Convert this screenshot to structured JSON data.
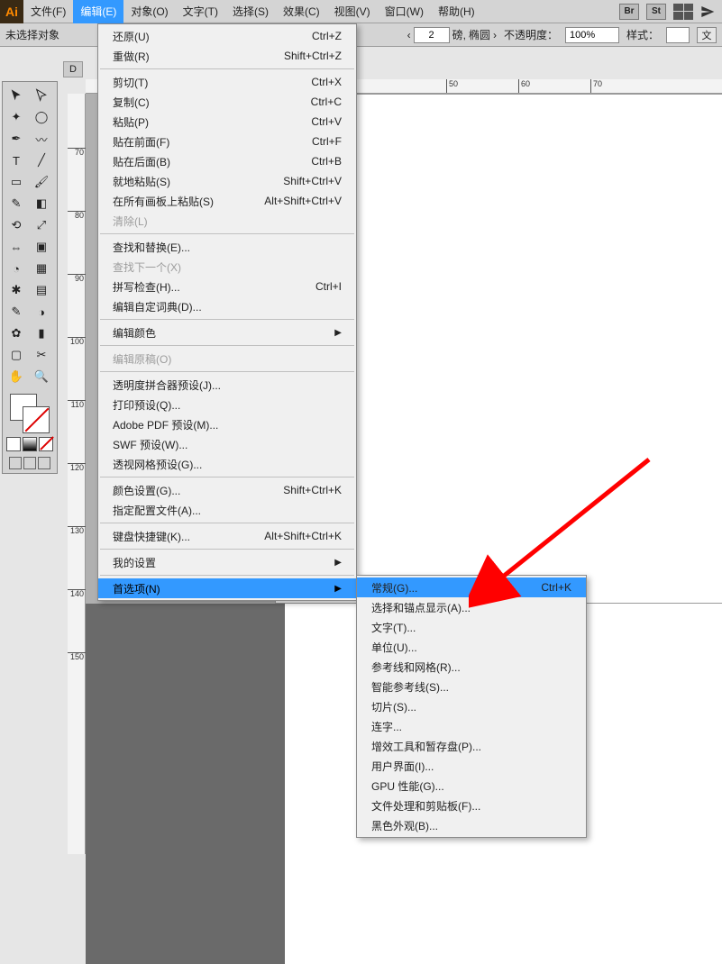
{
  "logo_text": "Ai",
  "menu": {
    "file": "文件(F)",
    "edit": "编辑(E)",
    "object": "对象(O)",
    "type": "文字(T)",
    "select": "选择(S)",
    "effect": "效果(C)",
    "view": "视图(V)",
    "window": "窗口(W)",
    "help": "帮助(H)"
  },
  "right_buttons": {
    "br": "Br",
    "st": "St"
  },
  "options": {
    "no_selection": "未选择对象",
    "stroke_val": "2",
    "stroke_unit": "磅,",
    "stroke_style": "椭圆",
    "opacity_label": "不透明度：",
    "opacity_val": "100%",
    "style_label": "样式：",
    "doc_btn": "文"
  },
  "tab": {
    "label": "D"
  },
  "h_ticks": [
    "50",
    "60",
    "70"
  ],
  "v_ticks": [
    "70",
    "80",
    "90",
    "100",
    "110",
    "120",
    "130",
    "140",
    "150"
  ],
  "dropdown": [
    {
      "label": "还原(U)",
      "short": "Ctrl+Z"
    },
    {
      "label": "重做(R)",
      "short": "Shift+Ctrl+Z"
    },
    {
      "sep": true
    },
    {
      "label": "剪切(T)",
      "short": "Ctrl+X"
    },
    {
      "label": "复制(C)",
      "short": "Ctrl+C"
    },
    {
      "label": "粘贴(P)",
      "short": "Ctrl+V"
    },
    {
      "label": "贴在前面(F)",
      "short": "Ctrl+F"
    },
    {
      "label": "贴在后面(B)",
      "short": "Ctrl+B"
    },
    {
      "label": "就地粘贴(S)",
      "short": "Shift+Ctrl+V"
    },
    {
      "label": "在所有画板上粘贴(S)",
      "short": "Alt+Shift+Ctrl+V"
    },
    {
      "label": "清除(L)",
      "disabled": true
    },
    {
      "sep": true
    },
    {
      "label": "查找和替换(E)..."
    },
    {
      "label": "查找下一个(X)",
      "disabled": true
    },
    {
      "label": "拼写检查(H)...",
      "short": "Ctrl+I"
    },
    {
      "label": "编辑自定词典(D)..."
    },
    {
      "sep": true
    },
    {
      "label": "编辑颜色",
      "arrow": true
    },
    {
      "sep": true
    },
    {
      "label": "编辑原稿(O)",
      "disabled": true
    },
    {
      "sep": true
    },
    {
      "label": "透明度拼合器预设(J)..."
    },
    {
      "label": "打印预设(Q)..."
    },
    {
      "label": "Adobe PDF 预设(M)..."
    },
    {
      "label": "SWF 预设(W)..."
    },
    {
      "label": "透视网格预设(G)..."
    },
    {
      "sep": true
    },
    {
      "label": "颜色设置(G)...",
      "short": "Shift+Ctrl+K"
    },
    {
      "label": "指定配置文件(A)..."
    },
    {
      "sep": true
    },
    {
      "label": "键盘快捷键(K)...",
      "short": "Alt+Shift+Ctrl+K"
    },
    {
      "sep": true
    },
    {
      "label": "我的设置",
      "arrow": true
    },
    {
      "sep": true
    },
    {
      "label": "首选项(N)",
      "arrow": true,
      "highlight": true
    }
  ],
  "submenu": [
    {
      "label": "常规(G)...",
      "short": "Ctrl+K",
      "highlight": true
    },
    {
      "label": "选择和锚点显示(A)..."
    },
    {
      "label": "文字(T)..."
    },
    {
      "label": "单位(U)..."
    },
    {
      "label": "参考线和网格(R)..."
    },
    {
      "label": "智能参考线(S)..."
    },
    {
      "label": "切片(S)..."
    },
    {
      "label": "连字..."
    },
    {
      "label": "增效工具和暂存盘(P)..."
    },
    {
      "label": "用户界面(I)..."
    },
    {
      "label": "GPU 性能(G)..."
    },
    {
      "label": "文件处理和剪贴板(F)..."
    },
    {
      "label": "黑色外观(B)..."
    }
  ]
}
